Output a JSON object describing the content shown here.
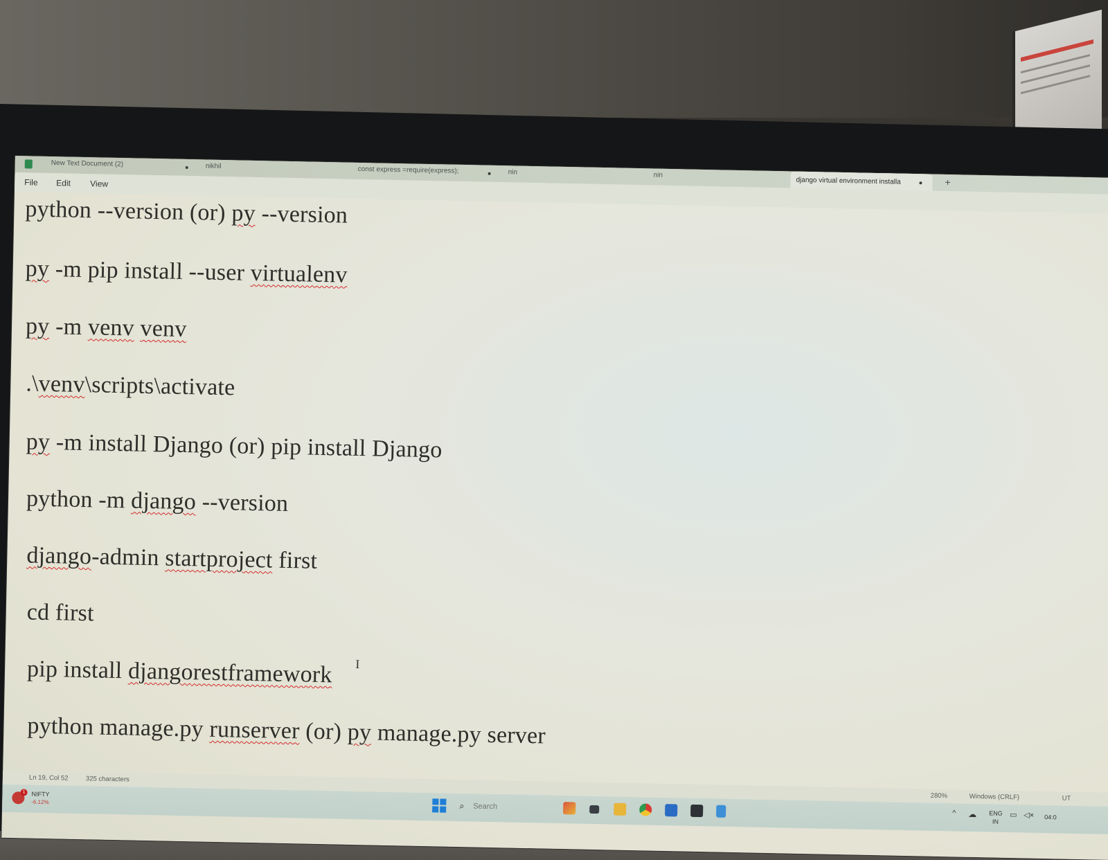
{
  "window": {
    "tabs": [
      {
        "label": "New Text Document (2)",
        "unsaved": true
      },
      {
        "label": "nikhil",
        "unsaved": false
      },
      {
        "label": "const express =require(express);",
        "unsaved": true
      },
      {
        "label": "nin",
        "unsaved": false
      },
      {
        "label": "nin",
        "unsaved": false
      },
      {
        "label": "django virtual environment installa",
        "unsaved": true,
        "active": true
      }
    ],
    "new_tab": "+"
  },
  "menu": {
    "file": "File",
    "edit": "Edit",
    "view": "View"
  },
  "editor": {
    "lines": [
      [
        {
          "t": "python --version  (or) "
        },
        {
          "t": "py",
          "s": true
        },
        {
          "t": " --version"
        }
      ],
      [
        {
          "t": "py",
          "s": true
        },
        {
          "t": " -m pip install --user "
        },
        {
          "t": "virtualenv",
          "s": true
        }
      ],
      [
        {
          "t": "py",
          "s": true
        },
        {
          "t": " -m "
        },
        {
          "t": "venv",
          "s": true
        },
        {
          "t": " "
        },
        {
          "t": "venv",
          "s": true
        }
      ],
      [
        {
          "t": ".\\"
        },
        {
          "t": "venv",
          "s": true
        },
        {
          "t": "\\scripts\\activate"
        }
      ],
      [
        {
          "t": "py",
          "s": true
        },
        {
          "t": " -m install Django (or) pip install Django"
        }
      ],
      [
        {
          "t": "python -m "
        },
        {
          "t": "django",
          "s": true
        },
        {
          "t": " --version"
        }
      ],
      [
        {
          "t": "django",
          "s": true
        },
        {
          "t": "-admin "
        },
        {
          "t": "startproject",
          "s": true
        },
        {
          "t": " first"
        }
      ],
      [
        {
          "t": "cd first"
        }
      ],
      [
        {
          "t": "pip install "
        },
        {
          "t": "djangorestframework",
          "s": true
        }
      ],
      [
        {
          "t": "python manage.py "
        },
        {
          "t": "runserver",
          "s": true
        },
        {
          "t": " (or) "
        },
        {
          "t": "py",
          "s": true
        },
        {
          "t": " manage.py server"
        }
      ]
    ]
  },
  "status": {
    "position": "Ln 19, Col 52",
    "characters": "325 characters",
    "zoom": "280%",
    "line_ending": "Windows (CRLF)",
    "encoding": "UT"
  },
  "taskbar": {
    "widget": {
      "name": "NIFTY",
      "value": "-6.12%",
      "badge": "1"
    },
    "search_placeholder": "Search",
    "apps": [
      "widgets-icon",
      "file-explorer-icon",
      "folder-icon",
      "chrome-icon",
      "store-icon",
      "terminal-icon",
      "notepad-icon"
    ],
    "tray": {
      "language": "ENG",
      "region": "IN",
      "time": "04:0"
    }
  },
  "colors": {
    "spellcheck": "#d42a2a",
    "editor_bg": "#e4e3d4",
    "start_blue": "#1f7fd6"
  }
}
